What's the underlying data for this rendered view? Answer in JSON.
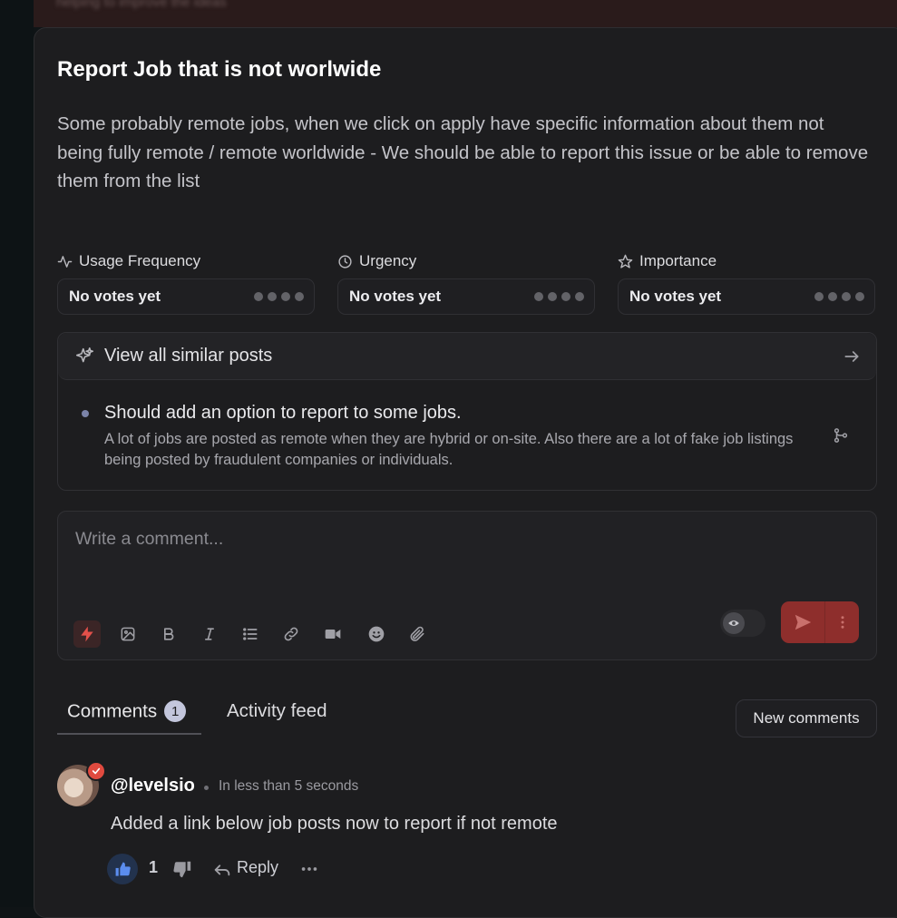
{
  "background_banner": {
    "text": "helping to improve the ideas"
  },
  "post": {
    "title": "Report Job that is not worlwide",
    "description": "Some probably remote jobs, when we click on apply have specific information about them not being fully remote / remote worldwide - We should be able to report this issue or be able to remove them from the list"
  },
  "metrics": [
    {
      "label": "Usage Frequency",
      "icon": "activity-icon",
      "value": "No votes yet"
    },
    {
      "label": "Urgency",
      "icon": "clock-icon",
      "value": "No votes yet"
    },
    {
      "label": "Importance",
      "icon": "star-icon",
      "value": "No votes yet"
    }
  ],
  "similar_posts": {
    "header": "View all similar posts",
    "items": [
      {
        "title": "Should add an option to report to some jobs.",
        "body": "A lot of jobs are posted as remote when they are hybrid or on-site. Also there are a lot of fake job listings being posted by fraudulent companies or individuals."
      }
    ]
  },
  "composer": {
    "placeholder": "Write a comment...",
    "toolbar_icons": [
      "lightning-icon",
      "image-icon",
      "bold-icon",
      "italic-icon",
      "list-icon",
      "link-icon",
      "video-icon",
      "emoji-icon",
      "attachment-icon"
    ]
  },
  "tabs": {
    "comments_label": "Comments",
    "comments_count": "1",
    "activity_label": "Activity feed",
    "new_comments_label": "New comments"
  },
  "comment": {
    "username": "@levelsio",
    "timestamp": "In less than 5 seconds",
    "text": "Added a link below job posts now to report if not remote",
    "likes": "1",
    "reply_label": "Reply"
  },
  "colors": {
    "accent_red": "#8e2e2c",
    "like_blue": "#5b8def",
    "verified_red": "#e04a3f",
    "card_bg": "#1d1d1f"
  }
}
